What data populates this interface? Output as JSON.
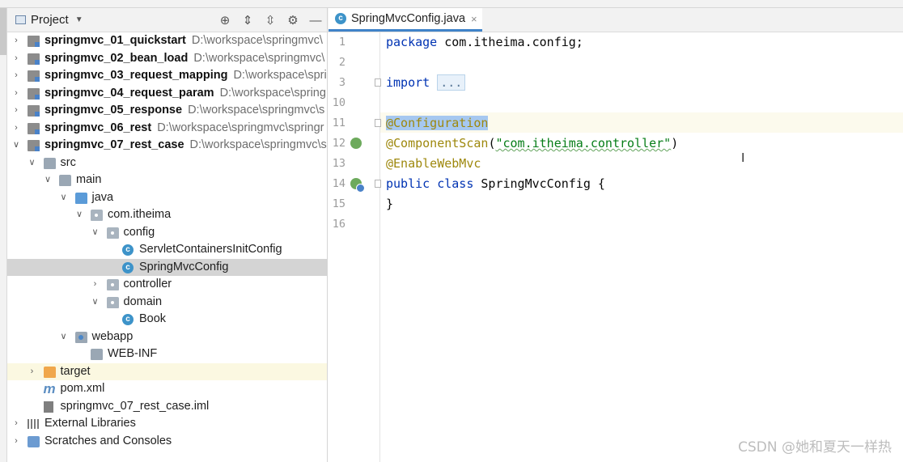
{
  "project_panel": {
    "title": "Project",
    "header_icons": [
      "locate-icon",
      "expand-all-icon",
      "collapse-all-icon",
      "settings-icon",
      "hide-icon"
    ],
    "tree": [
      {
        "label": "springmvc_01_quickstart",
        "path": "D:\\workspace\\springmvc\\",
        "type": "module",
        "depth": 0,
        "expanded": false,
        "bold": true
      },
      {
        "label": "springmvc_02_bean_load",
        "path": "D:\\workspace\\springmvc\\",
        "type": "module",
        "depth": 0,
        "expanded": false,
        "bold": true
      },
      {
        "label": "springmvc_03_request_mapping",
        "path": "D:\\workspace\\spri",
        "type": "module",
        "depth": 0,
        "expanded": false,
        "bold": true
      },
      {
        "label": "springmvc_04_request_param",
        "path": "D:\\workspace\\spring",
        "type": "module",
        "depth": 0,
        "expanded": false,
        "bold": true
      },
      {
        "label": "springmvc_05_response",
        "path": "D:\\workspace\\springmvc\\s",
        "type": "module",
        "depth": 0,
        "expanded": false,
        "bold": true
      },
      {
        "label": "springmvc_06_rest",
        "path": "D:\\workspace\\springmvc\\springr",
        "type": "module",
        "depth": 0,
        "expanded": false,
        "bold": true
      },
      {
        "label": "springmvc_07_rest_case",
        "path": "D:\\workspace\\springmvc\\s",
        "type": "module",
        "depth": 0,
        "expanded": true,
        "bold": true
      },
      {
        "label": "src",
        "type": "folder",
        "depth": 1,
        "expanded": true
      },
      {
        "label": "main",
        "type": "folder",
        "depth": 2,
        "expanded": true
      },
      {
        "label": "java",
        "type": "source-folder",
        "depth": 3,
        "expanded": true
      },
      {
        "label": "com.itheima",
        "type": "package",
        "depth": 4,
        "expanded": true
      },
      {
        "label": "config",
        "type": "package",
        "depth": 5,
        "expanded": true
      },
      {
        "label": "ServletContainersInitConfig",
        "type": "class",
        "depth": 6
      },
      {
        "label": "SpringMvcConfig",
        "type": "class",
        "depth": 6,
        "selected": true
      },
      {
        "label": "controller",
        "type": "package",
        "depth": 5,
        "expanded": false
      },
      {
        "label": "domain",
        "type": "package",
        "depth": 5,
        "expanded": true
      },
      {
        "label": "Book",
        "type": "class",
        "depth": 6
      },
      {
        "label": "webapp",
        "type": "web-folder",
        "depth": 3,
        "expanded": true
      },
      {
        "label": "WEB-INF",
        "type": "folder",
        "depth": 4
      },
      {
        "label": "target",
        "type": "excluded-folder",
        "depth": 1,
        "expanded": false,
        "highlight": true
      },
      {
        "label": "pom.xml",
        "type": "maven",
        "depth": 1
      },
      {
        "label": "springmvc_07_rest_case.iml",
        "type": "iml",
        "depth": 1
      },
      {
        "label": "External Libraries",
        "type": "libraries",
        "depth": 0,
        "expanded": false
      },
      {
        "label": "Scratches and Consoles",
        "type": "scratches",
        "depth": 0,
        "expanded": false
      }
    ]
  },
  "editor": {
    "tab": {
      "label": "SpringMvcConfig.java",
      "close": "×"
    },
    "line_numbers": [
      "1",
      "2",
      "3",
      "10",
      "11",
      "12",
      "13",
      "14",
      "15",
      "16"
    ],
    "code": {
      "package_kw": "package",
      "package_name": " com.itheima.config;",
      "import_kw": "import",
      "import_fold": "...",
      "ann_configuration": "@Configuration",
      "ann_component_scan": "@ComponentScan",
      "scan_open": "(",
      "scan_value": "\"com.itheima.controller\"",
      "scan_close": ")",
      "ann_enable_webmvc": "@EnableWebMvc",
      "public_kw": "public",
      "class_kw": "class",
      "class_name": " SpringMvcConfig {",
      "closing_brace": "}"
    }
  },
  "cursor_glyph": "I",
  "watermark": "CSDN @她和夏天一样热"
}
